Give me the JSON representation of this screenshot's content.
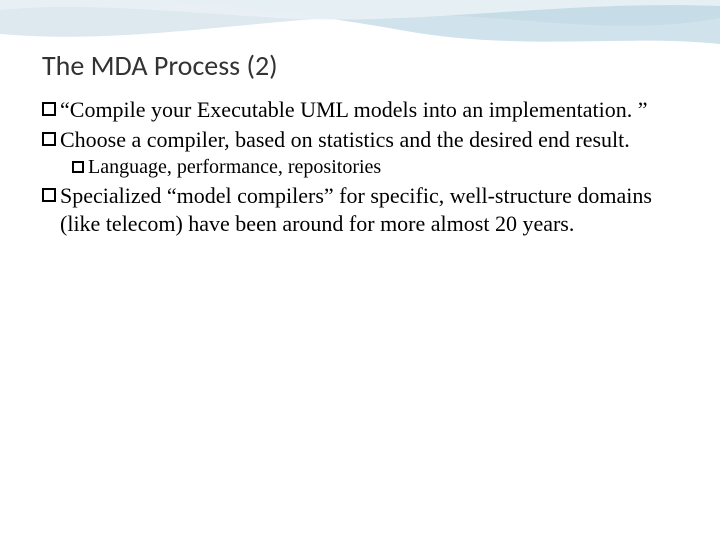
{
  "slide": {
    "title": "The MDA Process (2)",
    "bullets": [
      {
        "level": 1,
        "text": "“Compile your Executable UML models into an implementation. ”"
      },
      {
        "level": 1,
        "text": "Choose a compiler, based on statistics and the desired end result."
      },
      {
        "level": 2,
        "text": "Language, performance, repositories"
      },
      {
        "level": 1,
        "text": "Specialized “model compilers” for specific, well-structure domains (like telecom) have been around for more almost 20 years."
      }
    ]
  }
}
